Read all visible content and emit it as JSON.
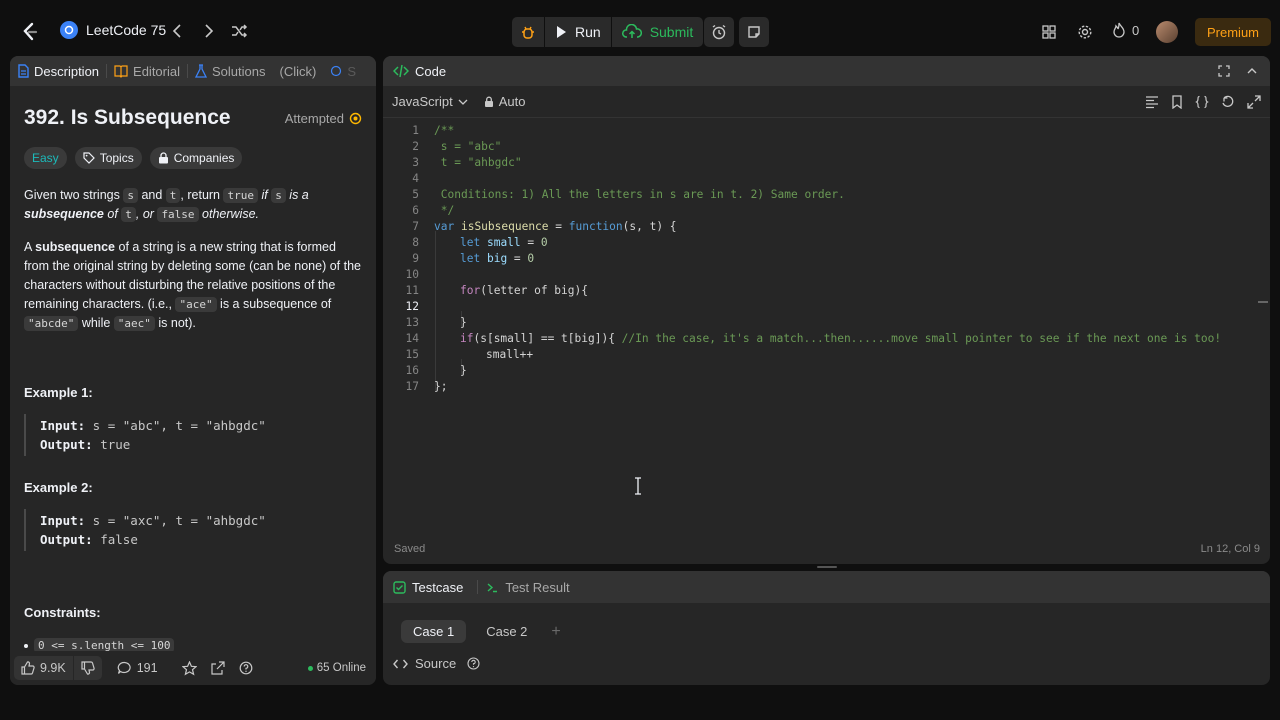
{
  "topbar": {
    "problem_list": "LeetCode 75",
    "run": "Run",
    "submit": "Submit",
    "streak_count": "0",
    "premium": "Premium"
  },
  "left_tabs": {
    "description": "Description",
    "editorial": "Editorial",
    "solutions": "Solutions",
    "click": "(Click)",
    "submissions": "S"
  },
  "problem": {
    "title": "392. Is Subsequence",
    "status": "Attempted",
    "difficulty": "Easy",
    "topics": "Topics",
    "companies": "Companies",
    "p1": {
      "a": "Given two strings ",
      "s": "s",
      "b": " and ",
      "t": "t",
      "c": ", return ",
      "true": "true",
      "d": " if ",
      "s2": "s",
      "e": " is a ",
      "subseq": "subsequence",
      "f": " of ",
      "t2": "t",
      "g": ", or ",
      "false": "false",
      "h": " otherwise."
    },
    "p2": {
      "a": "A ",
      "subseq": "subsequence",
      "b": " of a string is a new string that is formed from the original string by deleting some (can be none) of the characters without disturbing the relative positions of the remaining characters. (i.e., ",
      "ace": "\"ace\"",
      "c": " is a subsequence of ",
      "abcde": "\"abcde\"",
      "d": " while ",
      "aec": "\"aec\"",
      "e": " is not)."
    },
    "examples": [
      {
        "heading": "Example 1:",
        "input_label": "Input:",
        "input": " s = \"abc\", t = \"ahbgdc\"",
        "output_label": "Output:",
        "output": " true"
      },
      {
        "heading": "Example 2:",
        "input_label": "Input:",
        "input": " s = \"axc\", t = \"ahbgdc\"",
        "output_label": "Output:",
        "output": " false"
      }
    ],
    "constraints_heading": "Constraints:",
    "constraint_1": "0 <= s.length <= 100"
  },
  "left_footer": {
    "likes": "9.9K",
    "comments": "191",
    "online": "65 Online"
  },
  "code_panel": {
    "title": "Code",
    "language": "JavaScript",
    "auto": "Auto",
    "saved": "Saved",
    "cursor": "Ln 12, Col 9",
    "lines": [
      {
        "n": "1"
      },
      {
        "n": "2"
      },
      {
        "n": "3"
      },
      {
        "n": "4"
      },
      {
        "n": "5"
      },
      {
        "n": "6"
      },
      {
        "n": "7"
      },
      {
        "n": "8"
      },
      {
        "n": "9"
      },
      {
        "n": "10"
      },
      {
        "n": "11"
      },
      {
        "n": "12"
      },
      {
        "n": "13"
      },
      {
        "n": "14"
      },
      {
        "n": "15"
      },
      {
        "n": "16"
      },
      {
        "n": "17"
      }
    ],
    "code": {
      "l1": "/**",
      "l2": " s = \"abc\"",
      "l3": " t = \"ahbgdc\"",
      "l5": " Conditions: 1) All the letters in s are in t. 2) Same order.",
      "l6": " */",
      "l7_var": "var",
      "l7_name": "isSubsequence",
      "l7_eq": " = ",
      "l7_fn": "function",
      "l7_rest": "(s, t) {",
      "l8_let": "let",
      "l8_var": "small",
      "l8_eq": " = ",
      "l8_num": "0",
      "l9_let": "let",
      "l9_var": "big",
      "l9_eq": " = ",
      "l9_num": "0",
      "l11_for": "for",
      "l11_rest": "(letter of big){",
      "l13": "}",
      "l14_if": "if",
      "l14_code": "(s[small] == t[big]){ ",
      "l14_comment": "//In the case, it's a match...then......move small pointer to see if the next one is too!",
      "l15": "small++",
      "l16": "}",
      "l17": "};"
    }
  },
  "test_panel": {
    "testcase": "Testcase",
    "test_result": "Test Result",
    "case1": "Case 1",
    "case2": "Case 2",
    "add": "+",
    "source": "Source"
  },
  "colors": {
    "accent": "#ffa116",
    "easy": "#1cbaba",
    "submit": "#2cbb5d",
    "comment": "#6a9955",
    "keyword": "#569cd6",
    "string": "#ce9178"
  }
}
